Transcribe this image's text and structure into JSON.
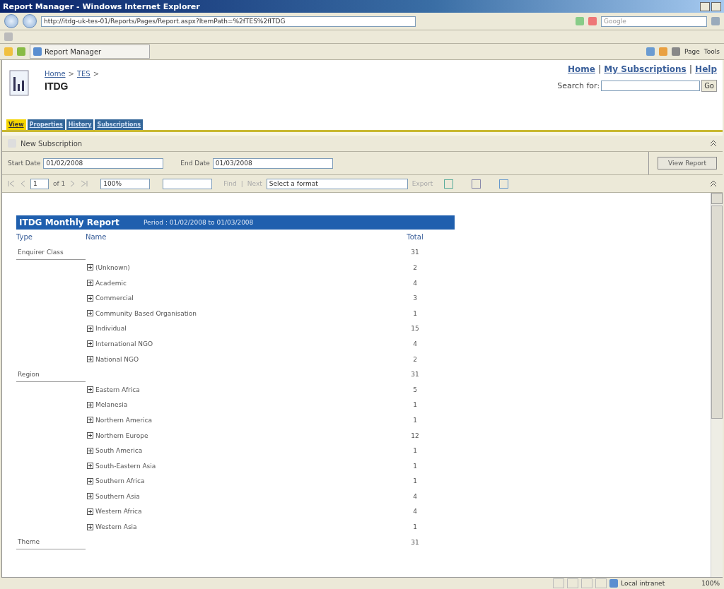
{
  "window": {
    "title": "Report Manager - Windows Internet Explorer"
  },
  "address_bar": {
    "url": "http://itdg-uk-tes-01/Reports/Pages/Report.aspx?ItemPath=%2fTES%2fITDG",
    "search_placeholder": "Google"
  },
  "browser_tab": {
    "label": "Report Manager"
  },
  "command_bar": [
    "Page",
    "Tools"
  ],
  "header": {
    "breadcrumb": [
      {
        "label": "Home",
        "separator": ">"
      },
      {
        "label": "TES",
        "separator": ">"
      }
    ],
    "link_separators": [
      "|",
      "|"
    ],
    "title": "ITDG",
    "links": [
      "Home",
      "My Subscriptions",
      "Help"
    ],
    "search_label": "Search for:",
    "search_button": "Go"
  },
  "tabs": [
    {
      "label": "View",
      "selected": true
    },
    {
      "label": "Properties",
      "selected": false
    },
    {
      "label": "History",
      "selected": false
    },
    {
      "label": "Subscriptions",
      "selected": false
    }
  ],
  "action": "New Subscription",
  "parameters": [
    {
      "label": "Start Date",
      "value": "01/02/2008"
    },
    {
      "label": "End Date",
      "value": "01/03/2008"
    }
  ],
  "view_button": "View Report",
  "report_toolbar": {
    "page": "1",
    "of": "of 1",
    "zoom": "100%",
    "find": "Find",
    "separator": "|",
    "next": "Next",
    "format": "Select a format",
    "export": "Export"
  },
  "report": {
    "title": "ITDG Monthly Report",
    "period": "Period : 01/02/2008 to 01/03/2008",
    "columns": [
      "Type",
      "Name",
      "Total"
    ],
    "groups": [
      {
        "type": "Enquirer Class",
        "total": "31",
        "children": [
          {
            "name": "(Unknown)",
            "total": "2",
            "expanded": false
          },
          {
            "name": "Academic",
            "total": "4",
            "expanded": false
          },
          {
            "name": "Commercial",
            "total": "3",
            "expanded": false
          },
          {
            "name": "Community Based Organisation",
            "total": "1",
            "expanded": false
          },
          {
            "name": "Individual",
            "total": "15",
            "expanded": false
          },
          {
            "name": "International NGO",
            "total": "4",
            "expanded": false
          },
          {
            "name": "National NGO",
            "total": "2",
            "expanded": false
          }
        ]
      },
      {
        "type": "Region",
        "total": "31",
        "children": [
          {
            "name": "Eastern Africa",
            "total": "5",
            "expanded": false
          },
          {
            "name": "Melanesia",
            "total": "1",
            "expanded": false
          },
          {
            "name": "Northern America",
            "total": "1",
            "expanded": false
          },
          {
            "name": "Northern Europe",
            "total": "12",
            "expanded": false
          },
          {
            "name": "South America",
            "total": "1",
            "expanded": false
          },
          {
            "name": "South-Eastern Asia",
            "total": "1",
            "expanded": false
          },
          {
            "name": "Southern Africa",
            "total": "1",
            "expanded": false
          },
          {
            "name": "Southern Asia",
            "total": "4",
            "expanded": false
          },
          {
            "name": "Western Africa",
            "total": "4",
            "expanded": false
          },
          {
            "name": "Western Asia",
            "total": "1",
            "expanded": false
          }
        ]
      },
      {
        "type": "Theme",
        "total": "31"
      }
    ]
  },
  "status_bar": {
    "zone": "Local intranet",
    "zoom": "100%"
  }
}
